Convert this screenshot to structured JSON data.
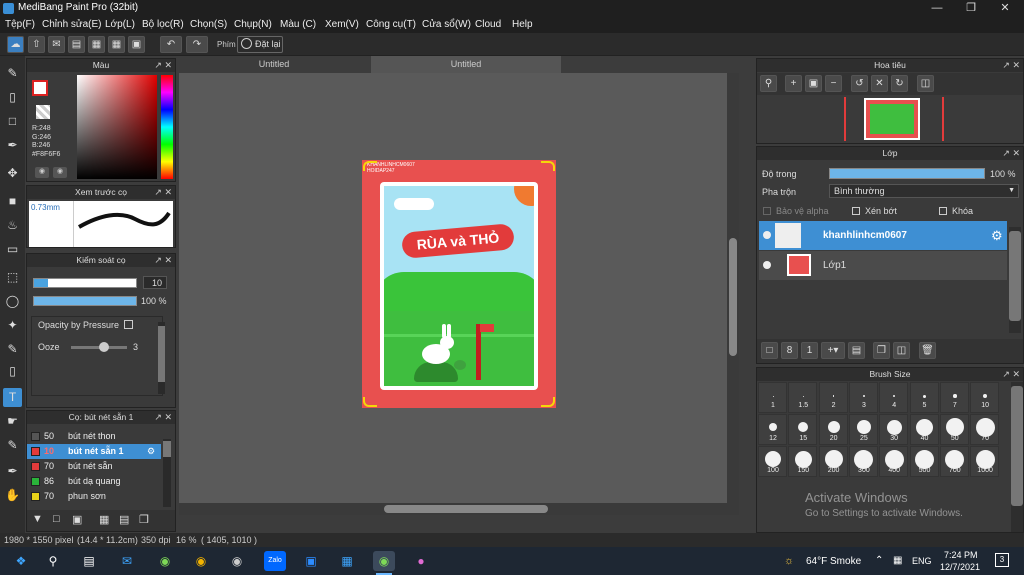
{
  "titlebar": {
    "title": "MediBang Paint Pro (32bit)"
  },
  "menu": [
    "Tệp(F)",
    "Chỉnh sửa(E)",
    "Lớp(L)",
    "Bộ lọc(R)",
    "Chọn(S)",
    "Chụp(N)",
    "Màu (C)",
    "Xem(V)",
    "Công cụ(T)",
    "Cửa sổ(W)",
    "Cloud",
    "Help"
  ],
  "toolbar": {
    "label_phim": "Phím",
    "reset": "Đặt lại"
  },
  "tabs": [
    "Untitled",
    "Untitled"
  ],
  "color_panel": {
    "title": "Màu",
    "r": "R:248",
    "g": "G:246",
    "b": "B:246",
    "hex": "#F8F6F6"
  },
  "preview_panel": {
    "title": "Xem trước cọ",
    "size": "0.73mm"
  },
  "brush_control": {
    "title": "Kiểm soát cọ",
    "size_value": "10",
    "opacity_value": "100 %",
    "opacity_pressure": "Opacity by Pressure",
    "ooze_label": "Ooze",
    "ooze_value": "3"
  },
  "brush_list": {
    "title": "Cọ: bút nét sẵn 1",
    "items": [
      {
        "size": "50",
        "name": "bút nét  thon",
        "color": "#555555"
      },
      {
        "size": "10",
        "name": "bút nét sẵn 1",
        "color": "#e23b3b"
      },
      {
        "size": "70",
        "name": "bút nét sẵn",
        "color": "#e23b3b"
      },
      {
        "size": "86",
        "name": "bút dạ quang",
        "color": "#2ab33a"
      },
      {
        "size": "70",
        "name": "phun sơn",
        "color": "#e8d21a"
      }
    ]
  },
  "navigator": {
    "title": "Hoa tiêu"
  },
  "layers": {
    "title": "Lớp",
    "opacity_label": "Độ trong",
    "opacity_value": "100 %",
    "blend_label": "Pha trộn",
    "blend_value": "Bình thường",
    "protect_alpha": "Bảo vệ alpha",
    "clip": "Xén bớt",
    "lock": "Khóa",
    "items": [
      {
        "name": "khanhlinhcm0607"
      },
      {
        "name": "Lớp1"
      }
    ]
  },
  "brush_size": {
    "title": "Brush Size",
    "sizes": [
      "1",
      "1.5",
      "2",
      "3",
      "4",
      "5",
      "7",
      "10",
      "12",
      "15",
      "20",
      "25",
      "30",
      "40",
      "50",
      "70",
      "100",
      "150",
      "200",
      "300",
      "400",
      "500",
      "700",
      "1000"
    ]
  },
  "artwork": {
    "signature": "KHANHLINHCM0607",
    "signature2": "HOIDAP247",
    "banner": "RÙA và THỎ"
  },
  "statusbar": {
    "dims": "1980 * 1550 pixel",
    "size_cm": "(14.4 * 11.2cm)",
    "dpi": "350 dpi",
    "zoom": "16 %",
    "coords": "( 1405, 1010 )"
  },
  "watermark": {
    "line1": "Activate Windows",
    "line2": "Go to Settings to activate Windows."
  },
  "taskbar": {
    "weather": "64°F  Smoke",
    "lang": "ENG",
    "time": "7:24 PM",
    "date": "12/7/2021",
    "notif": "3"
  },
  "colors": {
    "accent": "#3e9ad9",
    "selected_row": "#3e8fd3"
  }
}
